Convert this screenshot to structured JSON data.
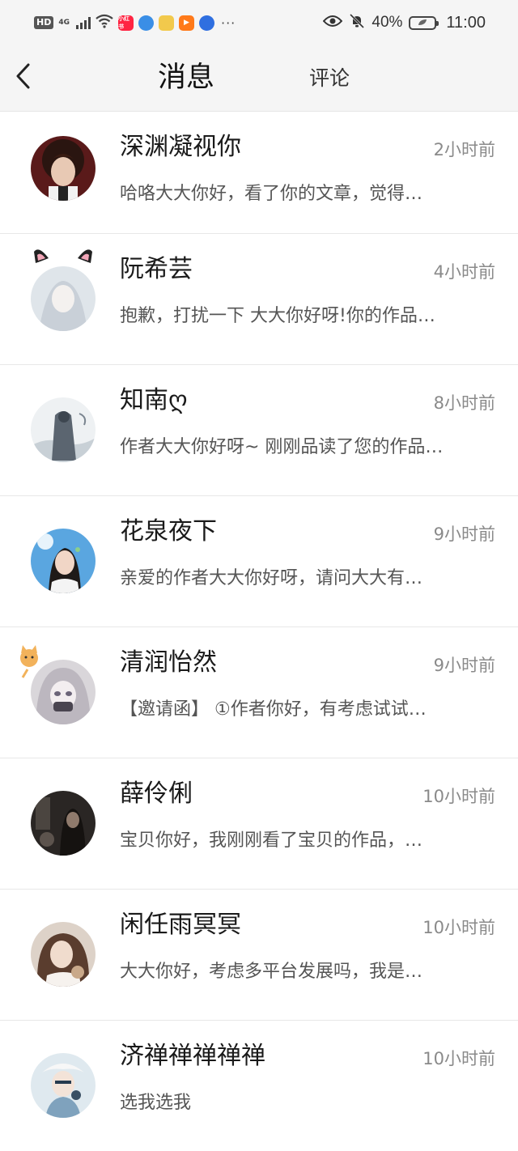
{
  "status_bar": {
    "hd": "HD",
    "network": "4G",
    "app_badge": "小红书",
    "battery_pct": "40%",
    "time": "11:00",
    "more": "···"
  },
  "header": {
    "title": "消息",
    "tab_comment": "评论"
  },
  "messages": [
    {
      "name": "深渊凝视你",
      "time": "2小时前",
      "preview": "哈咯大大你好，看了你的文章，觉得…",
      "avatar": "avatar-dark-hair"
    },
    {
      "name": "阮希芸",
      "time": "4小时前",
      "preview": "抱歉，打扰一下 大大你好呀!你的作品…",
      "avatar": "avatar-cat-ears"
    },
    {
      "name": "知南ღ",
      "time": "8小时前",
      "preview": "作者大大你好呀~ 刚刚品读了您的作品…",
      "avatar": "avatar-sketch-figure"
    },
    {
      "name": "花泉夜下",
      "time": "9小时前",
      "preview": "亲爱的作者大大你好呀，请问大大有…",
      "avatar": "avatar-girl-blue-sky"
    },
    {
      "name": "清润怡然",
      "time": "9小时前",
      "preview": "【邀请函】 ①作者你好，有考虑试试…",
      "avatar": "avatar-anime-girl"
    },
    {
      "name": "薛伶俐",
      "time": "10小时前",
      "preview": "宝贝你好，我刚刚看了宝贝的作品，…",
      "avatar": "avatar-dark-room"
    },
    {
      "name": "闲任雨冥冥",
      "time": "10小时前",
      "preview": "大大你好，考虑多平台发展吗，我是…",
      "avatar": "avatar-curly-hair"
    },
    {
      "name": "济禅禅禅禅禅",
      "time": "10小时前",
      "preview": "选我选我",
      "avatar": "avatar-white-hair-boy"
    }
  ]
}
